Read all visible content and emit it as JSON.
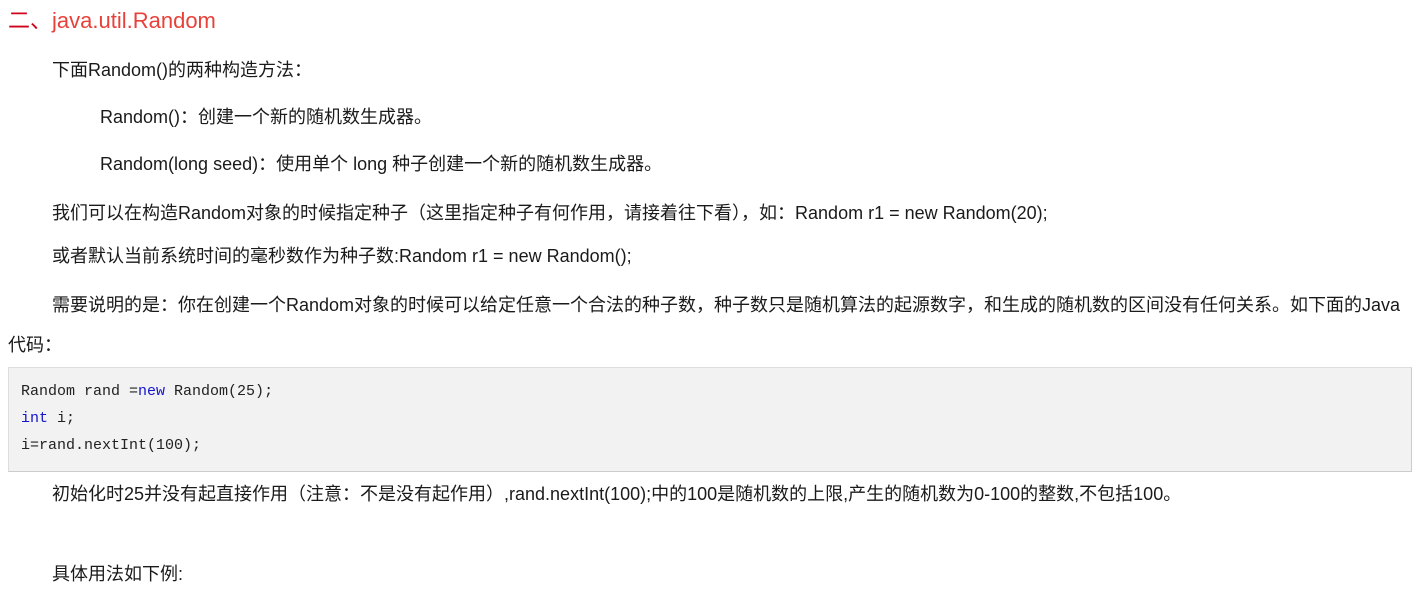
{
  "document": {
    "heading": {
      "number": "二、",
      "title": "java.util.Random",
      "color": "#e8413a"
    },
    "intro_line": "下面Random()的两种构造方法：",
    "constructors": [
      "Random()：创建一个新的随机数生成器。",
      "Random(long seed)：使用单个 long 种子创建一个新的随机数生成器。"
    ],
    "paragraphs": [
      "我们可以在构造Random对象的时候指定种子（这里指定种子有何作用，请接着往下看），如：Random r1 = new Random(20);",
      "或者默认当前系统时间的毫秒数作为种子数:Random r1 = new Random();",
      "需要说明的是：你在创建一个Random对象的时候可以给定任意一个合法的种子数，种子数只是随机算法的起源数字，和生成的随机数的区间没有任何关系。如下面的Java代码："
    ],
    "code_block": {
      "background": "#f2f2f2",
      "border_color": "#dddddd",
      "keyword_color": "#1414cc",
      "lines": [
        {
          "pre": "Random rand =",
          "keyword": "new",
          "post": " Random(25);"
        },
        {
          "pre": "",
          "keyword": "int",
          "post": " i;"
        },
        {
          "pre": "i=rand.nextInt(100);",
          "keyword": "",
          "post": ""
        }
      ]
    },
    "trailing_paragraphs": [
      "初始化时25并没有起直接作用（注意：不是没有起作用）,rand.nextInt(100);中的100是随机数的上限,产生的随机数为0-100的整数,不包括100。",
      "具体用法如下例:"
    ]
  }
}
